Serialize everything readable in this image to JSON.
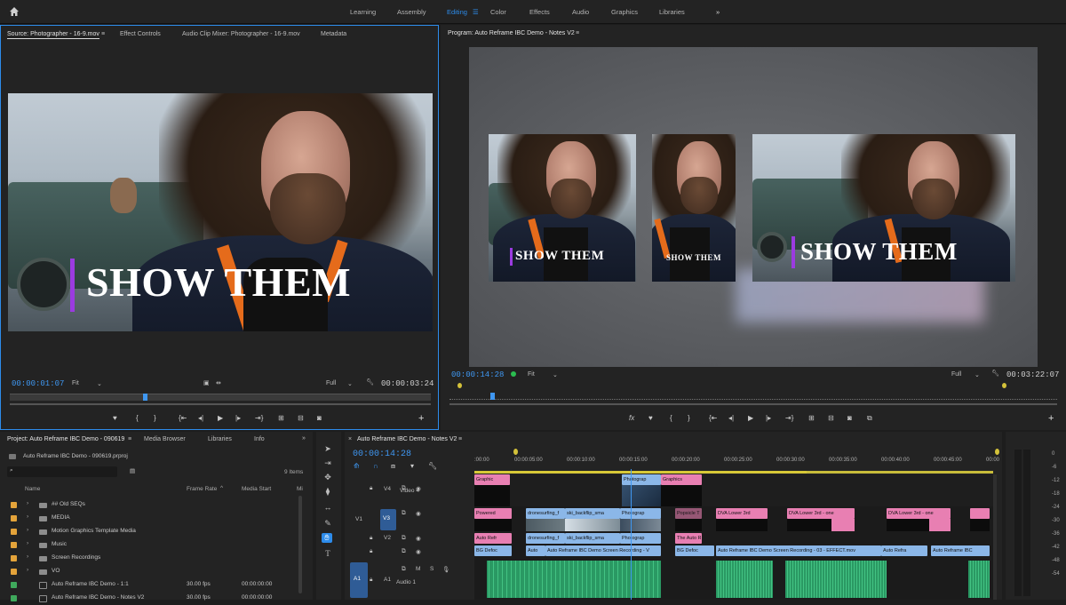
{
  "colors": {
    "accent": "#2d8ceb",
    "pink_clip": "#e87fb2",
    "blue_clip": "#8bb7e8",
    "audio_clip": "#38b071",
    "title_bar": "#9b3be0",
    "folder": "#e4a33a"
  },
  "workspaces": [
    "Learning",
    "Assembly",
    "Editing",
    "Color",
    "Effects",
    "Audio",
    "Graphics",
    "Libraries"
  ],
  "active_workspace": "Editing",
  "source": {
    "tabs": [
      "Source: Photographer - 16-9.mov",
      "Effect Controls",
      "Audio Clip Mixer: Photographer - 16-9.mov",
      "Metadata"
    ],
    "title_text": "SHOW THEM",
    "timecode": "00:00:01:07",
    "fit": "Fit",
    "quality": "Full",
    "duration": "00:00:03:24"
  },
  "program": {
    "tab": "Program: Auto Reframe IBC Demo - Notes V2",
    "title_text": "SHOW THEM",
    "timecode": "00:00:14:28",
    "fit": "Fit",
    "quality": "Full",
    "duration": "00:03:22:07"
  },
  "project": {
    "tabs": [
      "Project: Auto Reframe IBC Demo - 090619",
      "Media Browser",
      "Libraries",
      "Info"
    ],
    "file": "Auto Reframe IBC Demo - 090619.prproj",
    "item_count": "9 Items",
    "columns": {
      "name": "Name",
      "frame_rate": "Frame Rate",
      "media_start": "Media Start",
      "mi": "Mi"
    },
    "items": [
      {
        "name": "## Old SEQs",
        "type": "folder",
        "fr": "",
        "ms": ""
      },
      {
        "name": "MEDIA",
        "type": "folder",
        "fr": "",
        "ms": ""
      },
      {
        "name": "Motion Graphics Template Media",
        "type": "folder",
        "fr": "",
        "ms": ""
      },
      {
        "name": "Music",
        "type": "folder",
        "fr": "",
        "ms": ""
      },
      {
        "name": "Screen Recordings",
        "type": "folder",
        "fr": "",
        "ms": ""
      },
      {
        "name": "VO",
        "type": "folder",
        "fr": "",
        "ms": ""
      },
      {
        "name": "Auto Reframe IBC Demo - 1:1",
        "type": "seq",
        "fr": "30.00 fps",
        "ms": "00:00:00:00"
      },
      {
        "name": "Auto Reframe IBC Demo - Notes V2",
        "type": "seq",
        "fr": "30.00 fps",
        "ms": "00:00:00:00"
      }
    ]
  },
  "timeline": {
    "tab": "Auto Reframe IBC Demo - Notes V2",
    "timecode": "00:00:14:28",
    "ruler": [
      ":00:00",
      "00:00:05:00",
      "00:00:10:00",
      "00:00:15:00",
      "00:00:20:00",
      "00:00:25:00",
      "00:00:30:00",
      "00:00:35:00",
      "00:00:40:00",
      "00:00:45:00",
      "00:00"
    ],
    "tracks": {
      "v4": "V4",
      "v4_name": "Video 4",
      "v3": "V3",
      "v1": "V1",
      "v2": "V2",
      "a1": "A1",
      "a1_name": "Audio 1",
      "m": "M",
      "s": "S"
    },
    "clips": {
      "v4": [
        "Graphic",
        "Photograp",
        "Graphics"
      ],
      "v3": [
        "Powered",
        "dronesurfing_f",
        "ski_backflip_sma",
        "Photograp",
        "Popsicle T",
        "DVA Lower 3rd",
        "DVA Lower 3rd - one",
        "DVA Lower 3rd - one"
      ],
      "v2": [
        "Auto Refr",
        "dronesurfing_f",
        "ski_backflip_sma",
        "Photograp",
        "The Auto R"
      ],
      "v1": [
        "BG Defoc",
        "Auto",
        "Auto Reframe IBC Demo Screen Recording - V",
        "BG Defoc",
        "Auto Reframe IBC Demo Screen Recording - 03 - EFFECT.mov",
        "Auto Refra",
        "Auto Reframe IBC"
      ]
    }
  },
  "meter_scale": [
    "0",
    "-6",
    "-12",
    "-18",
    "-24",
    "-30",
    "-36",
    "-42",
    "-48",
    "-54"
  ]
}
